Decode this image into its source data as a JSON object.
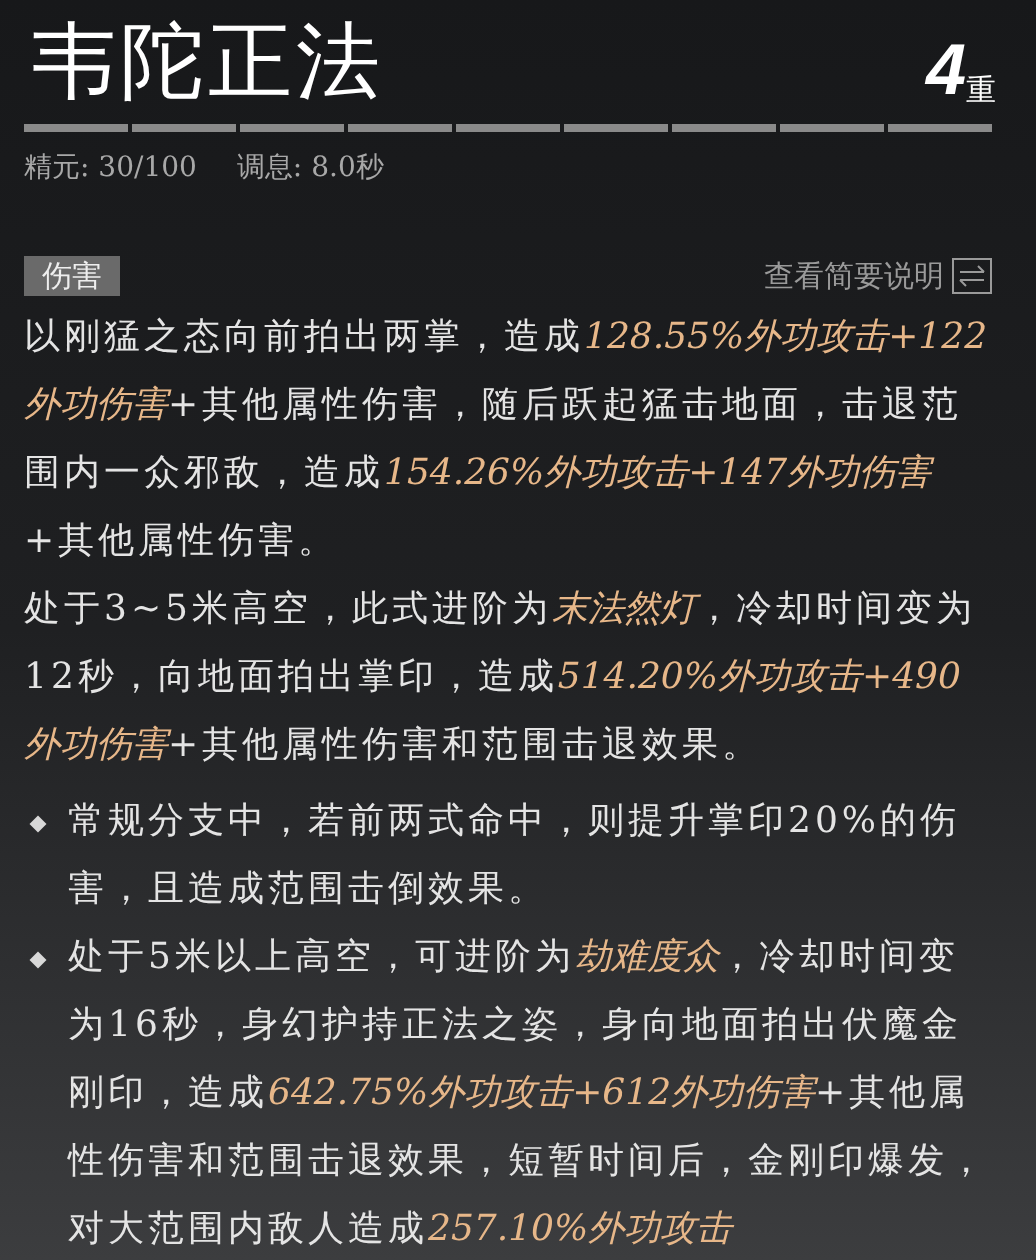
{
  "title": "韦陀正法",
  "rank": {
    "number": "4",
    "unit": "重"
  },
  "stats": [
    "精元: 30/100",
    "调息: 8.0秒"
  ],
  "section": {
    "tag": "伤害",
    "link": "查看简要说明"
  },
  "paragraphs": [
    "以刚猛之态向前拍出两掌，造成**128.55%外功攻击+122外功伤害**+其他属性伤害，随后跃起猛击地面，击退范围内一众邪敌，造成**154.26%外功攻击+147外功伤害**+其他属性伤害。",
    "处于3~5米高空，此式进阶为**末法然灯**，冷却时间变为12秒，向地面拍出掌印，造成**514.20%外功攻击+490外功伤害**+其他属性伤害和范围击退效果。"
  ],
  "bullets": [
    "常规分支中，若前两式命中，则提升掌印20%的伤害，且造成范围击倒效果。",
    "处于5米以上高空，可进阶为**劫难度众**，冷却时间变为16秒，身幻护持正法之姿，身向地面拍出伏魔金刚印，造成**642.75%外功攻击+612外功伤害**+其他属性伤害和范围击退效果，短暂时间后，金刚印爆发，对大范围内敌人造成**257.10%外功攻击**"
  ]
}
